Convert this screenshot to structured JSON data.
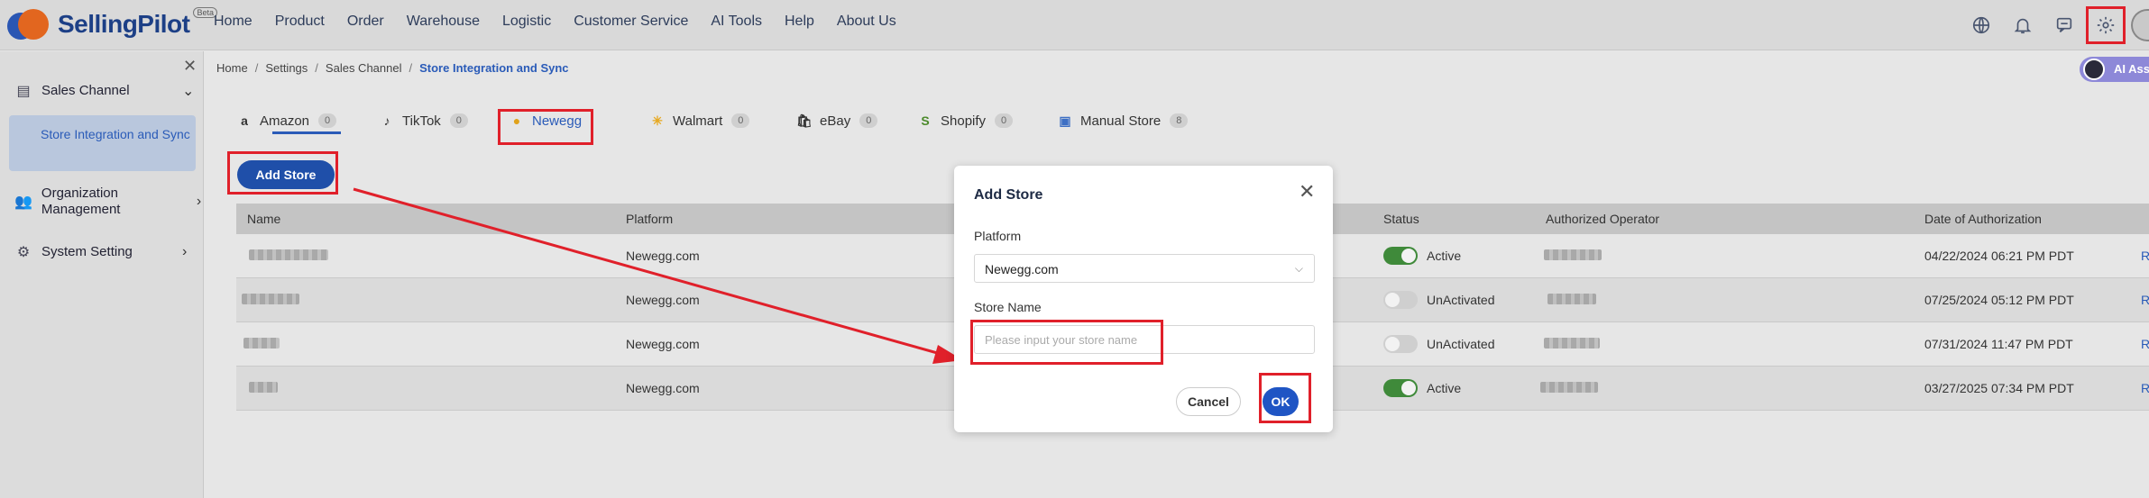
{
  "app": {
    "logo_text": "SellingPilot",
    "beta": "Beta"
  },
  "nav": [
    "Home",
    "Product",
    "Order",
    "Warehouse",
    "Logistic",
    "Customer Service",
    "AI Tools",
    "Help",
    "About Us"
  ],
  "top_icons": [
    "globe-icon",
    "bell-icon",
    "chat-icon",
    "gear-icon",
    "user-avatar"
  ],
  "sidebar": {
    "groups": [
      {
        "label": "Sales Channel",
        "icon": "store-icon",
        "expanded": true
      },
      {
        "label": "Organization Management",
        "icon": "people-icon",
        "expanded": false
      },
      {
        "label": "System Setting",
        "icon": "gear-icon",
        "expanded": false
      }
    ],
    "active_item": "Store Integration and Sync"
  },
  "breadcrumb": [
    "Home",
    "Settings",
    "Sales Channel",
    "Store Integration and Sync"
  ],
  "ai_assistant": "AI Ass",
  "tabs": [
    {
      "label": "Amazon",
      "count": "0",
      "icon": "a"
    },
    {
      "label": "TikTok",
      "count": "0",
      "icon": "♪"
    },
    {
      "label": "Newegg",
      "count": "",
      "icon": "●",
      "active": true
    },
    {
      "label": "Walmart",
      "count": "0",
      "icon": "✳"
    },
    {
      "label": "eBay",
      "count": "0",
      "icon": "🛍"
    },
    {
      "label": "Shopify",
      "count": "0",
      "icon": "S"
    },
    {
      "label": "Manual Store",
      "count": "8",
      "icon": "▣"
    }
  ],
  "add_store_label": "Add Store",
  "table": {
    "headers": [
      "Name",
      "Platform",
      "Status",
      "Authorized Operator",
      "Date of Authorization"
    ],
    "rows": [
      {
        "platform": "Newegg.com",
        "status": "Active",
        "on": true,
        "date": "04/22/2024 06:21 PM PDT",
        "action": "R"
      },
      {
        "platform": "Newegg.com",
        "status": "UnActivated",
        "on": false,
        "date": "07/25/2024 05:12 PM PDT",
        "action": "R"
      },
      {
        "platform": "Newegg.com",
        "status": "UnActivated",
        "on": false,
        "date": "07/31/2024 11:47 PM PDT",
        "action": "R"
      },
      {
        "platform": "Newegg.com",
        "status": "Active",
        "on": true,
        "date": "03/27/2025 07:34 PM PDT",
        "action": "R"
      }
    ]
  },
  "dialog": {
    "title": "Add Store",
    "platform_label": "Platform",
    "platform_value": "Newegg.com",
    "store_name_label": "Store Name",
    "store_name_placeholder": "Please input your store name",
    "cancel": "Cancel",
    "ok": "OK"
  },
  "colors": {
    "accent": "#2a5bb8",
    "primary_button": "#1f4fa9",
    "active_toggle": "#3f8a3a",
    "annotation_red": "#e0202a"
  }
}
